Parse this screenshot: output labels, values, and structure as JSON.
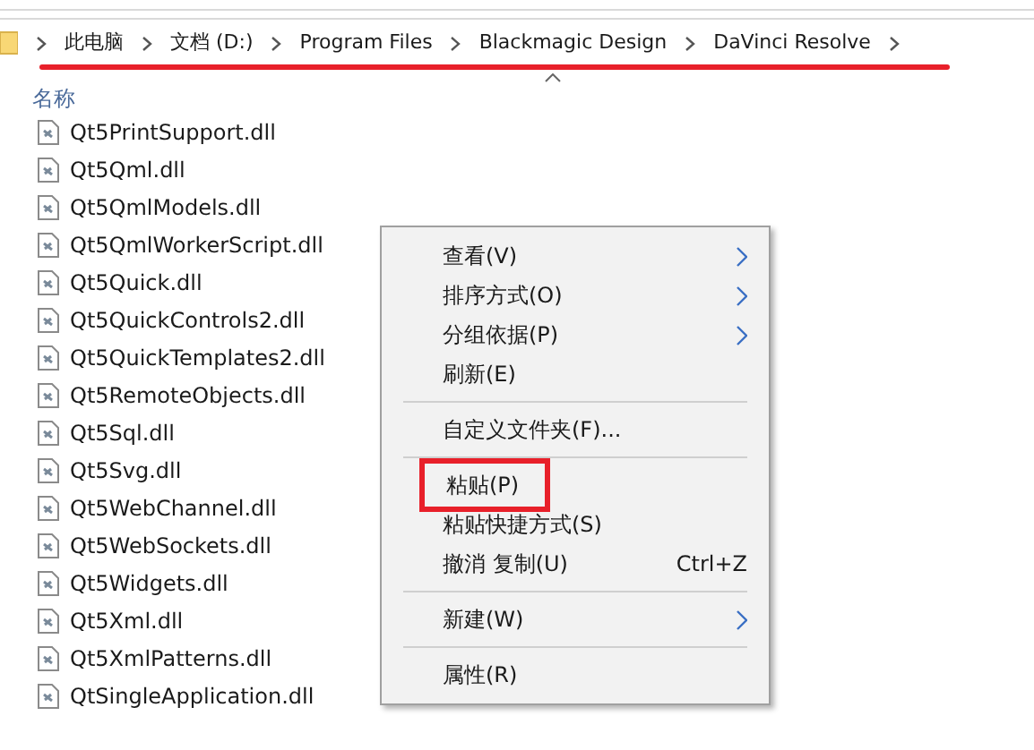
{
  "address": {
    "crumbs": [
      "此电脑",
      "文档 (D:)",
      "Program Files",
      "Blackmagic Design",
      "DaVinci Resolve"
    ],
    "marked": true
  },
  "column_header": "名称",
  "files": [
    "Qt5PrintSupport.dll",
    "Qt5Qml.dll",
    "Qt5QmlModels.dll",
    "Qt5QmlWorkerScript.dll",
    "Qt5Quick.dll",
    "Qt5QuickControls2.dll",
    "Qt5QuickTemplates2.dll",
    "Qt5RemoteObjects.dll",
    "Qt5Sql.dll",
    "Qt5Svg.dll",
    "Qt5WebChannel.dll",
    "Qt5WebSockets.dll",
    "Qt5Widgets.dll",
    "Qt5Xml.dll",
    "Qt5XmlPatterns.dll",
    "QtSingleApplication.dll"
  ],
  "context_menu": [
    {
      "kind": "item",
      "label": "查看(V)",
      "submenu": true,
      "marked": false
    },
    {
      "kind": "item",
      "label": "排序方式(O)",
      "submenu": true,
      "marked": false
    },
    {
      "kind": "item",
      "label": "分组依据(P)",
      "submenu": true,
      "marked": false
    },
    {
      "kind": "item",
      "label": "刷新(E)",
      "submenu": false,
      "marked": false
    },
    {
      "kind": "separator"
    },
    {
      "kind": "item",
      "label": "自定义文件夹(F)...",
      "submenu": false,
      "marked": false
    },
    {
      "kind": "separator"
    },
    {
      "kind": "item",
      "label": "粘贴(P)",
      "submenu": false,
      "marked": true
    },
    {
      "kind": "item",
      "label": "粘贴快捷方式(S)",
      "submenu": false,
      "marked": false
    },
    {
      "kind": "item",
      "label": "撤消 复制(U)",
      "shortcut": "Ctrl+Z",
      "submenu": false,
      "marked": false
    },
    {
      "kind": "separator"
    },
    {
      "kind": "item",
      "label": "新建(W)",
      "submenu": true,
      "marked": false
    },
    {
      "kind": "separator"
    },
    {
      "kind": "item",
      "label": "属性(R)",
      "submenu": false,
      "marked": false
    }
  ]
}
